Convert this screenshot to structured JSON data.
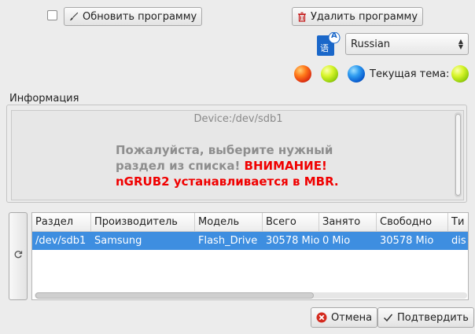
{
  "toolbar": {
    "update_label": "Обновить программу",
    "delete_label": "Удалить программу"
  },
  "language": {
    "selected": "Russian",
    "icon_glyph_a": "A",
    "icon_glyph_cn": "语"
  },
  "theme": {
    "label": "Текущая тема:",
    "colors": {
      "red": "#e8481a",
      "green": "#b6e515",
      "blue": "#1778e8"
    }
  },
  "info": {
    "group_label": "Информация",
    "device": "Device:/dev/sdb1",
    "line1": "Пожалуйста, выберите нужный",
    "line2_a": "раздел из списка! ",
    "line2_b": "ВНИМАНИЕ!",
    "line3": "nGRUB2 устанавливается в MBR."
  },
  "table": {
    "columns": [
      "Раздел",
      "Производитель",
      "Модель",
      "Всего",
      "Занято",
      "Свободно",
      "Ти"
    ],
    "rows": [
      [
        "/dev/sdb1",
        "Samsung",
        "Flash_Drive",
        "30578 Mio",
        "0 Mio",
        "30578 Mio",
        "dis"
      ]
    ]
  },
  "footer": {
    "cancel_label": "Отмена",
    "confirm_label": "Подтвердить"
  }
}
